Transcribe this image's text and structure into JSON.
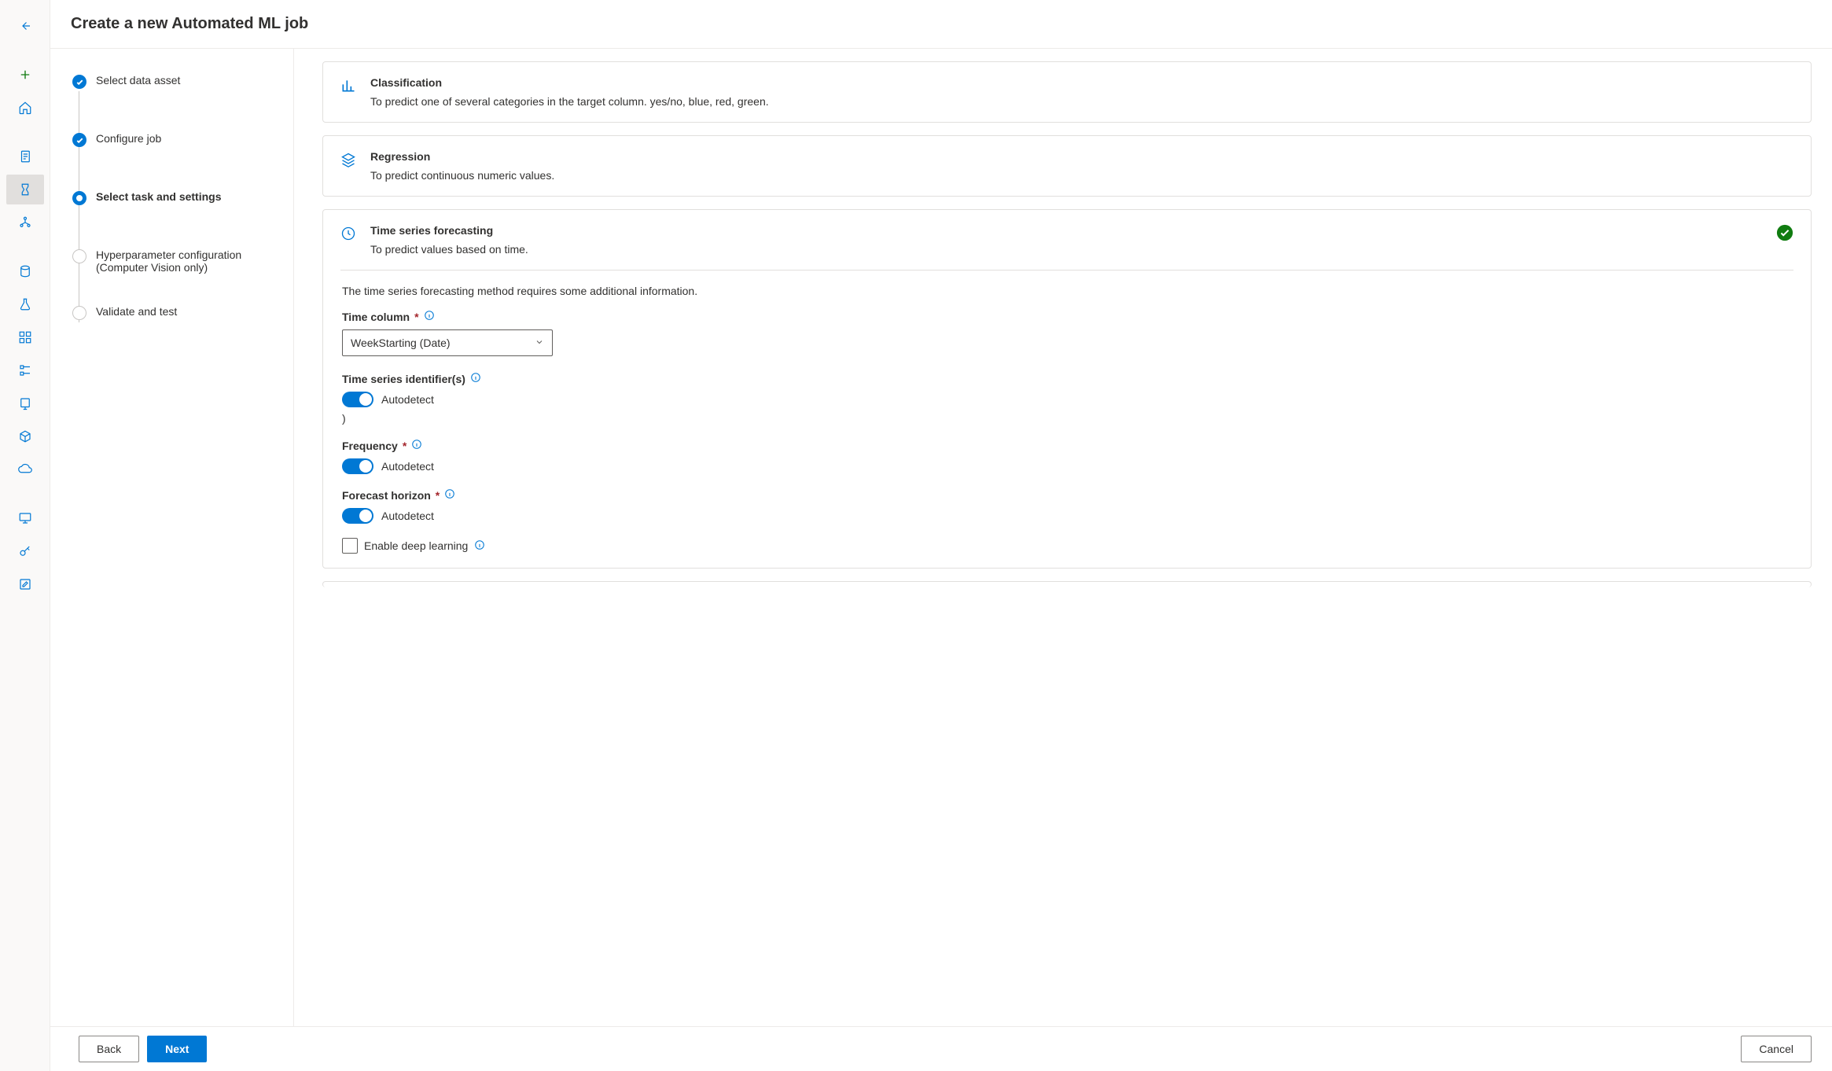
{
  "header": {
    "title": "Create a new Automated ML job"
  },
  "stepper": {
    "steps": [
      {
        "label": "Select data asset"
      },
      {
        "label": "Configure job"
      },
      {
        "label": "Select task and settings"
      },
      {
        "label": "Hyperparameter configuration (Computer Vision only)"
      },
      {
        "label": "Validate and test"
      }
    ]
  },
  "tasks": {
    "classification": {
      "title": "Classification",
      "desc": "To predict one of several categories in the target column. yes/no, blue, red, green."
    },
    "regression": {
      "title": "Regression",
      "desc": "To predict continuous numeric values."
    },
    "forecasting": {
      "title": "Time series forecasting",
      "desc": "To predict values based on time.",
      "note": "The time series forecasting method requires some additional information.",
      "time_column_label": "Time column",
      "time_column_value": "WeekStarting (Date)",
      "identifiers_label": "Time series identifier(s)",
      "identifiers_toggle": "Autodetect",
      "identifiers_extra": ")",
      "frequency_label": "Frequency",
      "frequency_toggle": "Autodetect",
      "horizon_label": "Forecast horizon",
      "horizon_toggle": "Autodetect",
      "deep_learning_label": "Enable deep learning"
    }
  },
  "footer": {
    "back": "Back",
    "next": "Next",
    "cancel": "Cancel"
  }
}
